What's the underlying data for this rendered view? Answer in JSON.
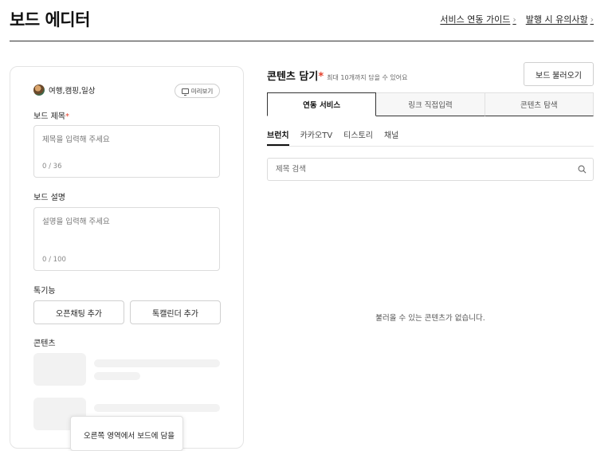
{
  "header": {
    "title": "보드 에디터",
    "links": [
      {
        "label": "서비스 연동 가이드"
      },
      {
        "label": "발행 시 유의사항"
      }
    ]
  },
  "editor": {
    "profile_name": "여행,캠핑,일상",
    "preview_label": "미리보기",
    "board_title": {
      "label": "보드 제목",
      "required_mark": "*",
      "placeholder": "제목을 입력해 주세요",
      "counter": "0 / 36"
    },
    "board_desc": {
      "label": "보드 설명",
      "placeholder": "설명을 입력해 주세요",
      "counter": "0 / 100"
    },
    "features": {
      "label": "톡기능",
      "open_chat_label": "오픈채팅 추가",
      "talk_calendar_label": "톡캘린더 추가"
    },
    "content_label": "콘텐츠",
    "tooltip_text": "오른쪽 영역에서 보드에 담을"
  },
  "content_panel": {
    "title": "콘텐츠 담기",
    "required_mark": "*",
    "hint": "최대 10개까지 담을 수 있어요",
    "load_button": "보드 불러오기",
    "tabs": [
      {
        "label": "연동 서비스",
        "active": true
      },
      {
        "label": "링크 직접입력",
        "active": false
      },
      {
        "label": "콘텐츠 탐색",
        "active": false
      }
    ],
    "subtabs": [
      {
        "label": "브런치",
        "active": true
      },
      {
        "label": "카카오TV",
        "active": false
      },
      {
        "label": "티스토리",
        "active": false
      },
      {
        "label": "채널",
        "active": false
      }
    ],
    "search_placeholder": "제목 검색",
    "empty_message": "불러올 수 있는 콘텐츠가 없습니다."
  }
}
